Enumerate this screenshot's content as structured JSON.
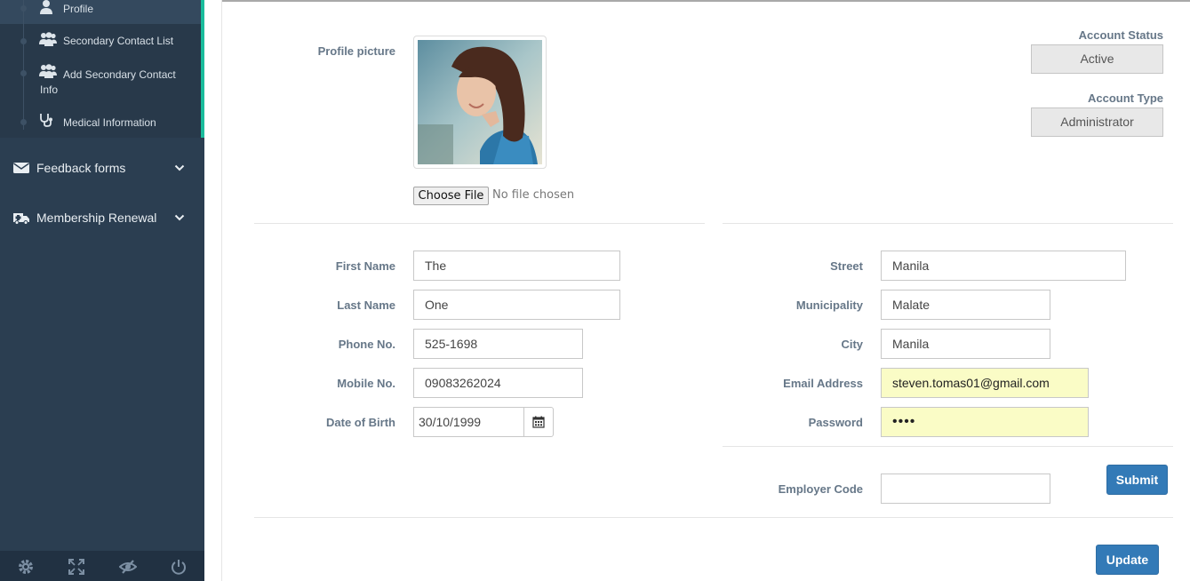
{
  "sidebar": {
    "sub_items": [
      {
        "label": "Profile",
        "icon": "user-icon"
      },
      {
        "label": "Secondary Contact List",
        "icon": "users-icon"
      },
      {
        "label": "Add Secondary Contact Info",
        "icon": "users-icon"
      },
      {
        "label": "Medical Information",
        "icon": "stethoscope-icon"
      }
    ],
    "nav_items": [
      {
        "label": "Feedback forms",
        "icon": "envelope-icon"
      },
      {
        "label": "Membership Renewal",
        "icon": "ambulance-icon"
      }
    ],
    "footer_icons": [
      "gear-icon",
      "fullscreen-icon",
      "eye-slash-icon",
      "power-icon"
    ]
  },
  "profile": {
    "picture_label": "Profile picture",
    "choose_file_label": "Choose File",
    "no_file_text": "No file chosen"
  },
  "account": {
    "status_label": "Account Status",
    "status_value": "Active",
    "type_label": "Account Type",
    "type_value": "Administrator"
  },
  "form_left": {
    "first_name": {
      "label": "First Name",
      "value": "The"
    },
    "last_name": {
      "label": "Last Name",
      "value": "One"
    },
    "phone": {
      "label": "Phone No.",
      "value": "525-1698"
    },
    "mobile": {
      "label": "Mobile No.",
      "value": "09083262024"
    },
    "dob": {
      "label": "Date of Birth",
      "value": "30/10/1999"
    }
  },
  "form_right": {
    "street": {
      "label": "Street",
      "value": "Manila"
    },
    "municipality": {
      "label": "Municipality",
      "value": "Malate"
    },
    "city": {
      "label": "City",
      "value": "Manila"
    },
    "email": {
      "label": "Email Address",
      "value": "steven.tomas01@gmail.com"
    },
    "password": {
      "label": "Password",
      "value": "••••"
    }
  },
  "employer": {
    "label": "Employer Code",
    "value": "",
    "submit_label": "Submit"
  },
  "update_label": "Update",
  "colors": {
    "sidebar_bg": "#2b3e51",
    "accent": "#1abc9c",
    "primary_button": "#337ab7",
    "autofill_bg": "#fafcc6"
  }
}
